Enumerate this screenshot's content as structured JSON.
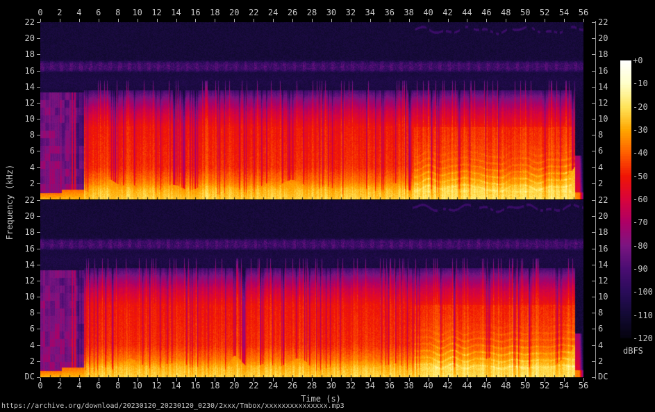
{
  "figure": {
    "background": "#000000",
    "text_color": "#c8c8c8",
    "caption_url": "https://archive.org/download/20230120_20230120_0230/2xxx/Tmbox/xxxxxxxxxxxxxxx.mp3"
  },
  "chart_data": {
    "type": "heatmap",
    "subtype": "stereo-audio-spectrogram-two-stacked-channels",
    "xlabel": "Time (s)",
    "ylabel": "Frequency (kHz)",
    "channels": [
      "left",
      "right"
    ],
    "x_axis": {
      "unit": "s",
      "min": 0,
      "max": 56,
      "tick_labels": [
        "0",
        "2",
        "4",
        "6",
        "8",
        "10",
        "12",
        "14",
        "16",
        "18",
        "20",
        "22",
        "24",
        "26",
        "28",
        "30",
        "32",
        "34",
        "36",
        "38",
        "40",
        "42",
        "44",
        "46",
        "48",
        "50",
        "52",
        "54",
        "56"
      ]
    },
    "y_axis": {
      "unit": "kHz",
      "min": 0,
      "max": 22,
      "tick_labels": [
        "22",
        "20",
        "18",
        "16",
        "14",
        "12",
        "10",
        "8",
        "6",
        "4",
        "2"
      ],
      "dc_label": "DC"
    },
    "colorbar": {
      "label": "dBFS",
      "range_db": [
        0,
        -120
      ],
      "ticks": [
        "+0",
        "-10",
        "-20",
        "-30",
        "-40",
        "-50",
        "-60",
        "-70",
        "-80",
        "-90",
        "-100",
        "-110",
        "-120"
      ],
      "palette_stops": [
        {
          "db": 0,
          "color": "#ffffff"
        },
        {
          "db": -10,
          "color": "#ffffc8"
        },
        {
          "db": -20,
          "color": "#ffe45a"
        },
        {
          "db": -30,
          "color": "#ffa600"
        },
        {
          "db": -40,
          "color": "#ff5f00"
        },
        {
          "db": -50,
          "color": "#f01505"
        },
        {
          "db": -60,
          "color": "#d8043c"
        },
        {
          "db": -70,
          "color": "#ad0066"
        },
        {
          "db": -80,
          "color": "#7b1581"
        },
        {
          "db": -90,
          "color": "#4a0d72"
        },
        {
          "db": -100,
          "color": "#2a0c5a"
        },
        {
          "db": -110,
          "color": "#130a34"
        },
        {
          "db": -120,
          "color": "#05030e"
        }
      ]
    },
    "features": {
      "noise_floor_db": -112,
      "pilot_tone": {
        "center_khz": 16.55,
        "half_width_khz": 0.62,
        "boost_db": 14,
        "blip_period_s": 1.0
      },
      "hf_noise_band": {
        "center_khz": 14.6,
        "half_width_khz": 1.3,
        "boost_db": 3
      },
      "whistle": {
        "start_s": 38.2,
        "base_khz": 21.05,
        "level_db": -96
      },
      "intro": {
        "end_s": 4.45,
        "top_khz": 13.3,
        "level_db": -86,
        "transient_times_s": [
          3.25,
          3.55
        ],
        "dim_after_s": 3.75,
        "bass_level_db": -29
      },
      "music": {
        "start_s": 4.45,
        "end_s": 55.1,
        "top_khz": 13.6,
        "envelope_db_by_khz": [
          [
            0,
            -26
          ],
          [
            1.2,
            -30
          ],
          [
            2.2,
            -40
          ],
          [
            4,
            -50
          ],
          [
            9,
            -54
          ],
          [
            11,
            -66
          ],
          [
            12.5,
            -80
          ],
          [
            13.6,
            -95
          ]
        ],
        "column_variation_db": 11,
        "gap_probability": 0.1,
        "spike_probability": 0.12,
        "bass_band_top_khz": 1.15
      },
      "vocals": {
        "start_s": 38.5,
        "end_s": 55.1,
        "harmonic_spacing_khz": 0.42,
        "boost_db": 9,
        "center_khz": 3.2,
        "extra_boost_db": 3
      },
      "ending": {
        "sweep_start_s": 53.0,
        "sweep_top_khz": 4.6,
        "tail_start_s": 55.1,
        "fade_out_s": 55.95
      }
    }
  }
}
